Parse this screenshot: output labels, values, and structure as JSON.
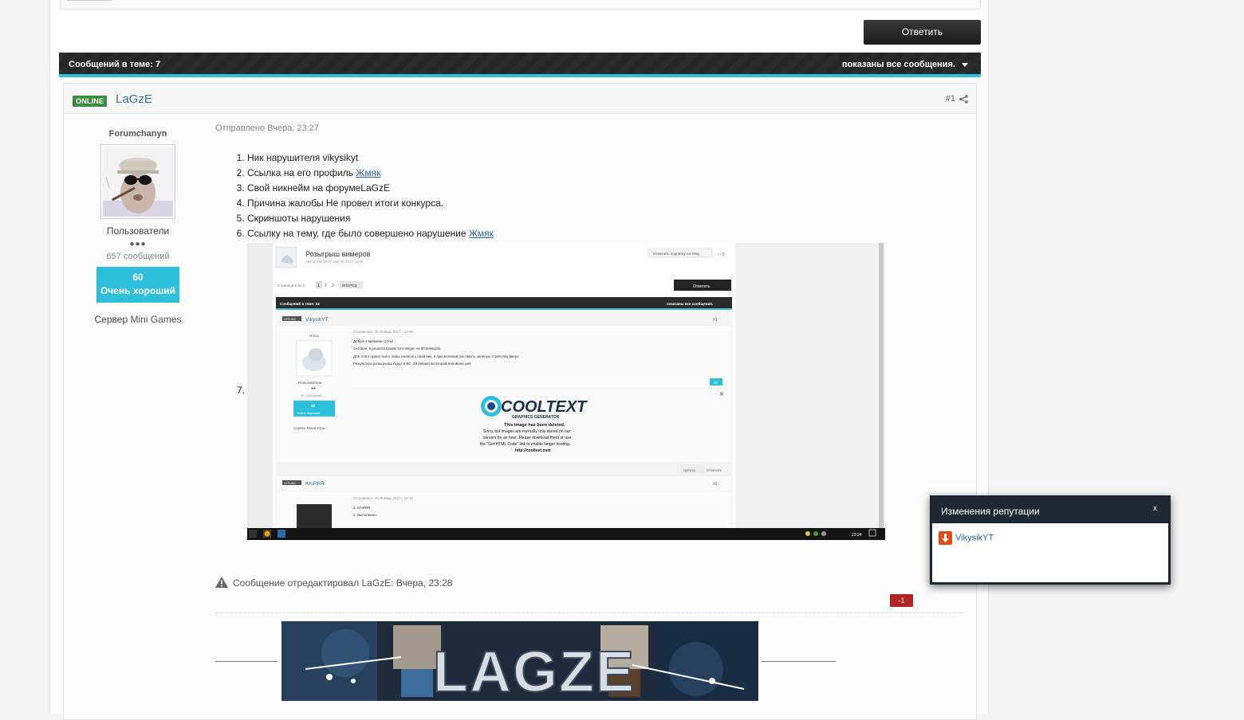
{
  "toolbar": {
    "reply_label": "Ответить"
  },
  "topic_bar": {
    "count_label": "Сообщений в теме: 7",
    "filter_label": "показаны все сообщения."
  },
  "post": {
    "online_badge": "ONLINE",
    "author": "LaGzE",
    "number": "#1",
    "posted": "Отправлено Вчера, 23:27",
    "list": [
      {
        "text": "Ник нарушителя vikysikyt",
        "link": ""
      },
      {
        "text": "Ссылка на его профиль ",
        "link": "Жмяк"
      },
      {
        "text": "Свой никнейм на форумеLaGzE",
        "link": ""
      },
      {
        "text": "Причина жалобы Не провел итоги конкурса.",
        "link": ""
      },
      {
        "text": "Скриншоты нарушения",
        "link": ""
      },
      {
        "text": "Ссылку на тему, где было совершено нарушение ",
        "link": "Жмяк"
      }
    ],
    "item7_number": "7.",
    "edited": "Сообщение отредактировал LaGzE: Вчера, 23:28"
  },
  "user": {
    "rank_title": "Forumchanyn",
    "group": "Пользователи",
    "pips": "●●●",
    "posts_count": "657 сообщений",
    "rep_value": "60",
    "rep_label": "Очень хороший",
    "server_prefix": "Сервер ",
    "server_name": "Mini Games"
  },
  "screenshot": {
    "topic_title": "Розыгрыш вимеров",
    "topic_meta": "Автор VikysikYT, янв 25 2017 19:05",
    "subscribe": "Отменить подписку на тему",
    "pager": "Страница 1 из 3",
    "pages": [
      "1",
      "2",
      "3"
    ],
    "next": "ВПЕРЕД",
    "reply": "Ответить",
    "count": "Сообщений в теме: 44",
    "filter": "показаны все сообщения.",
    "post1_author": "VikysikYT",
    "post1_num": "#1",
    "post1_rank": "Игрок",
    "post1_posted": "Отправлено 25 Январь 2017 - 19:05",
    "post1_lines": [
      "Доброго времени суток!",
      "Сегодня, я решила провести конкурс на 50 вимеров.",
      "Для этого нужно всего лишь написать свой ник, и при желании поставить зеленую стрелочку вверх",
      "Результаты розыгрыша будут в ВС, 29 января во второй половине дня"
    ],
    "post1_group": "Пользователи",
    "post1_pips": "●●",
    "post1_posts": "54 сообщений",
    "post1_rep": "39",
    "post1_rep_label": "Очень хороший",
    "post1_server": "Сервер Мини Игры",
    "post1_score": "50",
    "cooltext_logo": "COOLTEXT",
    "cooltext_sub": "GRAPHICS GENERATOR",
    "cooltext_msg1": "This image has been deleted.",
    "cooltext_msg2": "Sorry, but images are normally only stored on our",
    "cooltext_msg3": "servers for an hour. Please download them or use",
    "cooltext_msg4": "the \"Get HTML Code\" link to enable longer hosting.",
    "cooltext_msg5": "http://cooltext.com",
    "quote": "Цитата",
    "answer": "Ответить",
    "post2_author": "KmRRR",
    "post2_num": "#2",
    "post2_posted": "Отправлено 25 Январь 2017 - 19:16",
    "post2_lines": [
      "1. KmRRR",
      "2. Выполнено."
    ],
    "taskbar_time": "23:24"
  },
  "signature": {
    "banner_text": "LAGZE"
  },
  "rep_popup": {
    "title": "Изменения репутации",
    "close": "x",
    "entry": "VikysikYT",
    "minus": "-1"
  },
  "colors": {
    "accent": "#2ebfdc",
    "link": "#2a67b5",
    "online": "#3a8a3f",
    "negative": "#b22424",
    "popup_header": "#1e2935"
  }
}
